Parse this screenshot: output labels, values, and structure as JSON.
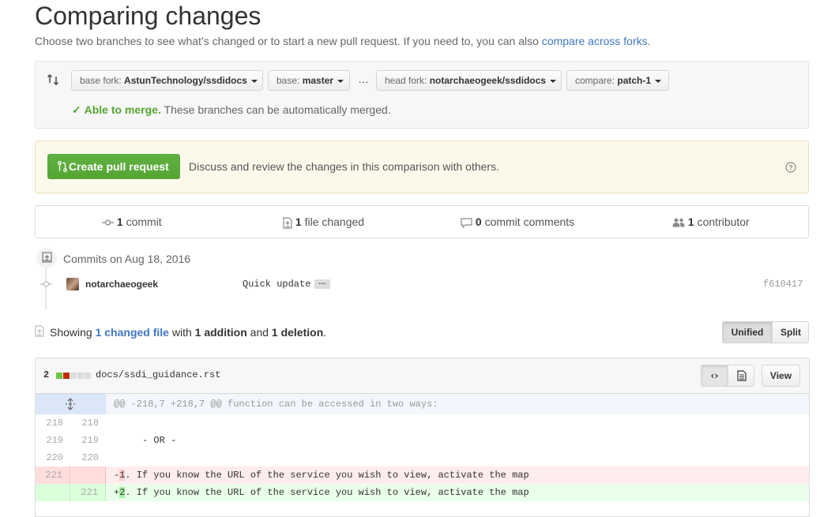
{
  "header": {
    "title": "Comparing changes",
    "subtitle": "Choose two branches to see what’s changed or to start a new pull request. If you need to, you can also",
    "subtitle_link": "compare across forks",
    "subtitle_end": "."
  },
  "range": {
    "base_fork_label": "base fork:",
    "base_fork_value": "AstunTechnology/ssdidocs",
    "base_label": "base:",
    "base_value": "master",
    "ellipsis": "…",
    "head_fork_label": "head fork:",
    "head_fork_value": "notarchaeogeek/ssdidocs",
    "compare_label": "compare:",
    "compare_value": "patch-1",
    "merge_status": "Able to merge.",
    "merge_text": "These branches can be automatically merged."
  },
  "pull_request": {
    "button_label": "Create pull request",
    "description": "Discuss and review the changes in this comparison with others."
  },
  "summary": {
    "commits_count": "1",
    "commits_label": "commit",
    "files_count": "1",
    "files_label": "file changed",
    "comments_count": "0",
    "comments_label": "commit comments",
    "contributors_count": "1",
    "contributors_label": "contributor"
  },
  "commits": {
    "date_heading": "Commits on Aug 18, 2016",
    "items": [
      {
        "author": "notarchaeogeek",
        "message": "Quick update",
        "more": "…",
        "sha": "f610417"
      }
    ]
  },
  "diff_summary": {
    "showing": "Showing",
    "changed_files": "1 changed file",
    "with": "with",
    "additions": "1 addition",
    "and": "and",
    "deletions": "1 deletion",
    "end": ".",
    "view_unified": "Unified",
    "view_split": "Split"
  },
  "file": {
    "changes_count": "2",
    "path": "docs/ssdi_guidance.rst",
    "view_button": "View",
    "hunk_header": "@@ -218,7 +218,7 @@ function can be accessed in two ways:",
    "lines": [
      {
        "old": "218",
        "new": "218",
        "type": "context",
        "text": ""
      },
      {
        "old": "219",
        "new": "219",
        "type": "context",
        "text": "     - OR -"
      },
      {
        "old": "220",
        "new": "220",
        "type": "context",
        "text": ""
      },
      {
        "old": "221",
        "new": "",
        "type": "deletion",
        "marker": "-",
        "highlight": "1",
        "text": ". If you know the URL of the service you wish to view, activate the map"
      },
      {
        "old": "",
        "new": "221",
        "type": "addition",
        "marker": "+",
        "highlight": "2",
        "text": ". If you know the URL of the service you wish to view, activate the map"
      }
    ]
  },
  "colors": {
    "green": "#55a532",
    "link": "#4078c0",
    "deletion_bg": "#ffecec",
    "deletion_num_bg": "#ffdddd",
    "addition_bg": "#eaffea",
    "addition_num_bg": "#dbffdb",
    "hunk_bg": "#f3f7fd"
  }
}
